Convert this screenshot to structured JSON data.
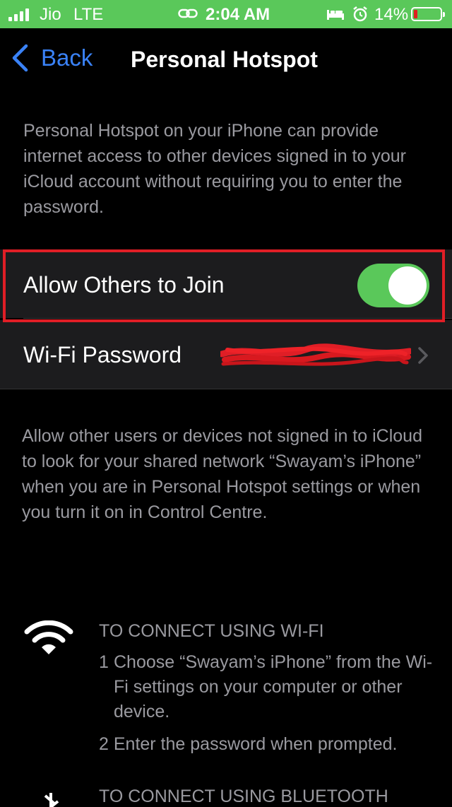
{
  "status_bar": {
    "carrier": "Jio",
    "network": "LTE",
    "time": "2:04 AM",
    "battery": "14%"
  },
  "nav": {
    "back_label": "Back",
    "title": "Personal Hotspot"
  },
  "intro_text": "Personal Hotspot on your iPhone can provide internet access to other devices signed in to your iCloud account without requiring you to enter the password.",
  "allow_row": {
    "label": "Allow Others to Join",
    "enabled": true
  },
  "wifi_row": {
    "label": "Wi-Fi Password"
  },
  "footer_text": "Allow other users or devices not signed in to iCloud to look for your shared network “Swayam’s iPhone” when you are in Personal Hotspot settings or when you turn it on in Control Centre.",
  "wifi_instructions": {
    "title": "TO CONNECT USING WI-FI",
    "step1_num": "1",
    "step1": "Choose “Swayam’s iPhone” from the Wi-Fi settings on your computer or other device.",
    "step2_num": "2",
    "step2": "Enter the password when prompted."
  },
  "bt_instructions": {
    "title": "TO CONNECT USING BLUETOOTH"
  },
  "colors": {
    "status_green": "#5ac85a",
    "accent_blue": "#3a82f7",
    "highlight_red": "#e01e26",
    "toggle_on": "#5ac85a"
  }
}
